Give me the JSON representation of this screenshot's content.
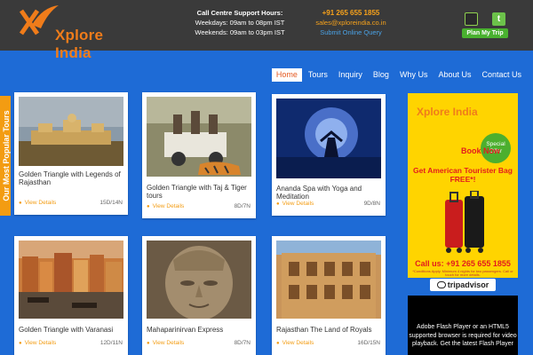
{
  "header": {
    "logo_text": "Xplore India",
    "support_heading": "Call Centre Support Hours:",
    "support_weekdays": "Weekdays: 09am to 08pm IST",
    "support_weekends": "Weekends: 09am to 03pm IST",
    "phone": "+91 265 655 1855",
    "email": "sales@xploreindia.co.in",
    "query_link": "Submit Online Query",
    "plan_button": "Plan My Trip"
  },
  "nav": {
    "items": [
      {
        "label": "Home"
      },
      {
        "label": "Tours"
      },
      {
        "label": "Inquiry"
      },
      {
        "label": "Blog"
      },
      {
        "label": "Why Us"
      },
      {
        "label": "About Us"
      },
      {
        "label": "Contact Us"
      }
    ]
  },
  "side_tab": "Our Most Popular Tours",
  "tours": [
    {
      "title": "Golden Triangle with Legends of Rajasthan",
      "link": "View Details",
      "duration": "15D/14N"
    },
    {
      "title": "Golden Triangle with Taj & Tiger tours",
      "link": "View Details",
      "duration": "8D/7N"
    },
    {
      "title": "Ananda Spa with Yoga and Meditation",
      "link": "View Details",
      "duration": "9D/8N"
    },
    {
      "title": "Golden Triangle with Varanasi",
      "link": "View Details",
      "duration": "12D/11N"
    },
    {
      "title": "Mahaparinirvan Express",
      "link": "View Details",
      "duration": "8D/7N"
    },
    {
      "title": "Rajasthan The Land of Royals",
      "link": "View Details",
      "duration": "16D/15N"
    }
  ],
  "ad": {
    "logo": "Xplore India",
    "special": "Special Offer",
    "book_now": "Book Now",
    "get_bag": "Get American Tourister Bag FREE*!",
    "call_us": "Call us: +91 265 655 1855",
    "fine_print": "*Conditions Apply. Minimum 4 nights for two passengers. Call or touch for more details."
  },
  "tripadvisor": "tripadvisor",
  "flash_notice": "Adobe Flash Player or an HTML5 supported browser is required for video playback. Get the latest Flash Player",
  "colors": {
    "page_bg": "#1e6bd6",
    "header_bg": "#3a3a3a",
    "accent_orange": "#f39c12",
    "brand_orange": "#f07c1a"
  }
}
